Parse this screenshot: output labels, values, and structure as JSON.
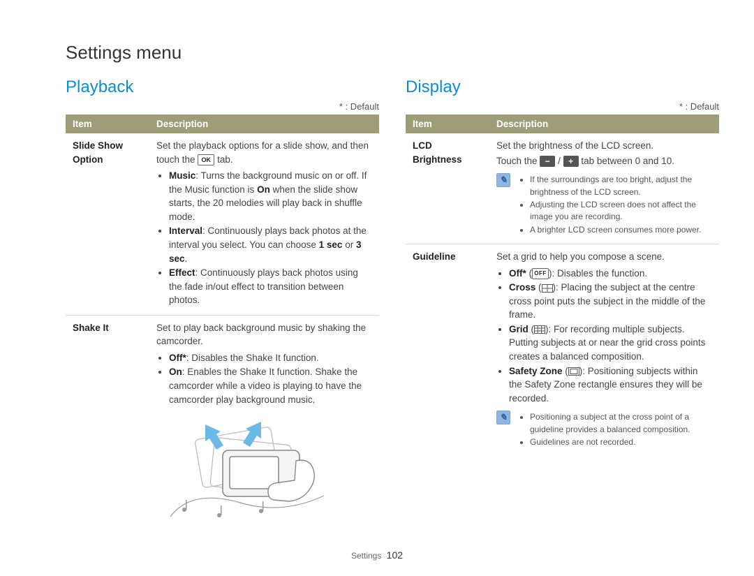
{
  "page_title": "Settings menu",
  "footer": {
    "section": "Settings",
    "page": "102"
  },
  "default_note": "* : Default",
  "table_headers": {
    "item": "Item",
    "desc": "Description"
  },
  "playback": {
    "heading": "Playback",
    "rows": {
      "slideshow": {
        "item": "Slide Show Option",
        "intro_a": "Set the playback options for a slide show, and then touch the ",
        "intro_b": " tab.",
        "music_label": "Music",
        "music_text": ": Turns the background music on or off. If the Music function is ",
        "music_on": "On",
        "music_text2": " when the slide show starts, the 20 melodies will play back in shuffle mode.",
        "interval_label": "Interval",
        "interval_text": ": Continuously plays back photos at the interval you select. You can choose ",
        "interval_opt1": "1 sec",
        "interval_or": " or ",
        "interval_opt2": "3 sec",
        "interval_period": ".",
        "effect_label": "Effect",
        "effect_text": ": Continuously plays back photos using the fade in/out effect to transition between photos."
      },
      "shakeit": {
        "item": "Shake It",
        "intro": "Set to play back background music by shaking the camcorder.",
        "off_label": "Off*",
        "off_text": ": Disables the Shake It function.",
        "on_label": "On",
        "on_text": ": Enables the Shake It function. Shake the camcorder while a video is playing to have the camcorder play background music."
      }
    }
  },
  "display": {
    "heading": "Display",
    "rows": {
      "lcd": {
        "item": "LCD Brightness",
        "line1": "Set the brightness of the LCD screen.",
        "line2a": "Touch the ",
        "line2b": " / ",
        "line2c": " tab between 0 and 10.",
        "note1": "If the surroundings are too bright, adjust the brightness of the LCD screen.",
        "note2": "Adjusting the LCD screen does not affect the image you are recording.",
        "note3": "A brighter LCD screen consumes more power."
      },
      "guideline": {
        "item": "Guideline",
        "intro": "Set a grid to help you compose a scene.",
        "off_label": "Off*",
        "off_text": ": Disables the function.",
        "cross_label": "Cross",
        "cross_text": ": Placing the subject at the centre cross point puts the subject in the middle of the frame.",
        "grid_label": "Grid",
        "grid_text": ": For recording multiple subjects. Putting subjects at or near the grid cross points creates a balanced composition.",
        "safety_label": "Safety Zone",
        "safety_text": ": Positioning subjects within the Safety Zone rectangle ensures they will be recorded.",
        "note1": "Positioning a subject at the cross point of a guideline provides a balanced composition.",
        "note2": "Guidelines are not recorded."
      }
    }
  }
}
